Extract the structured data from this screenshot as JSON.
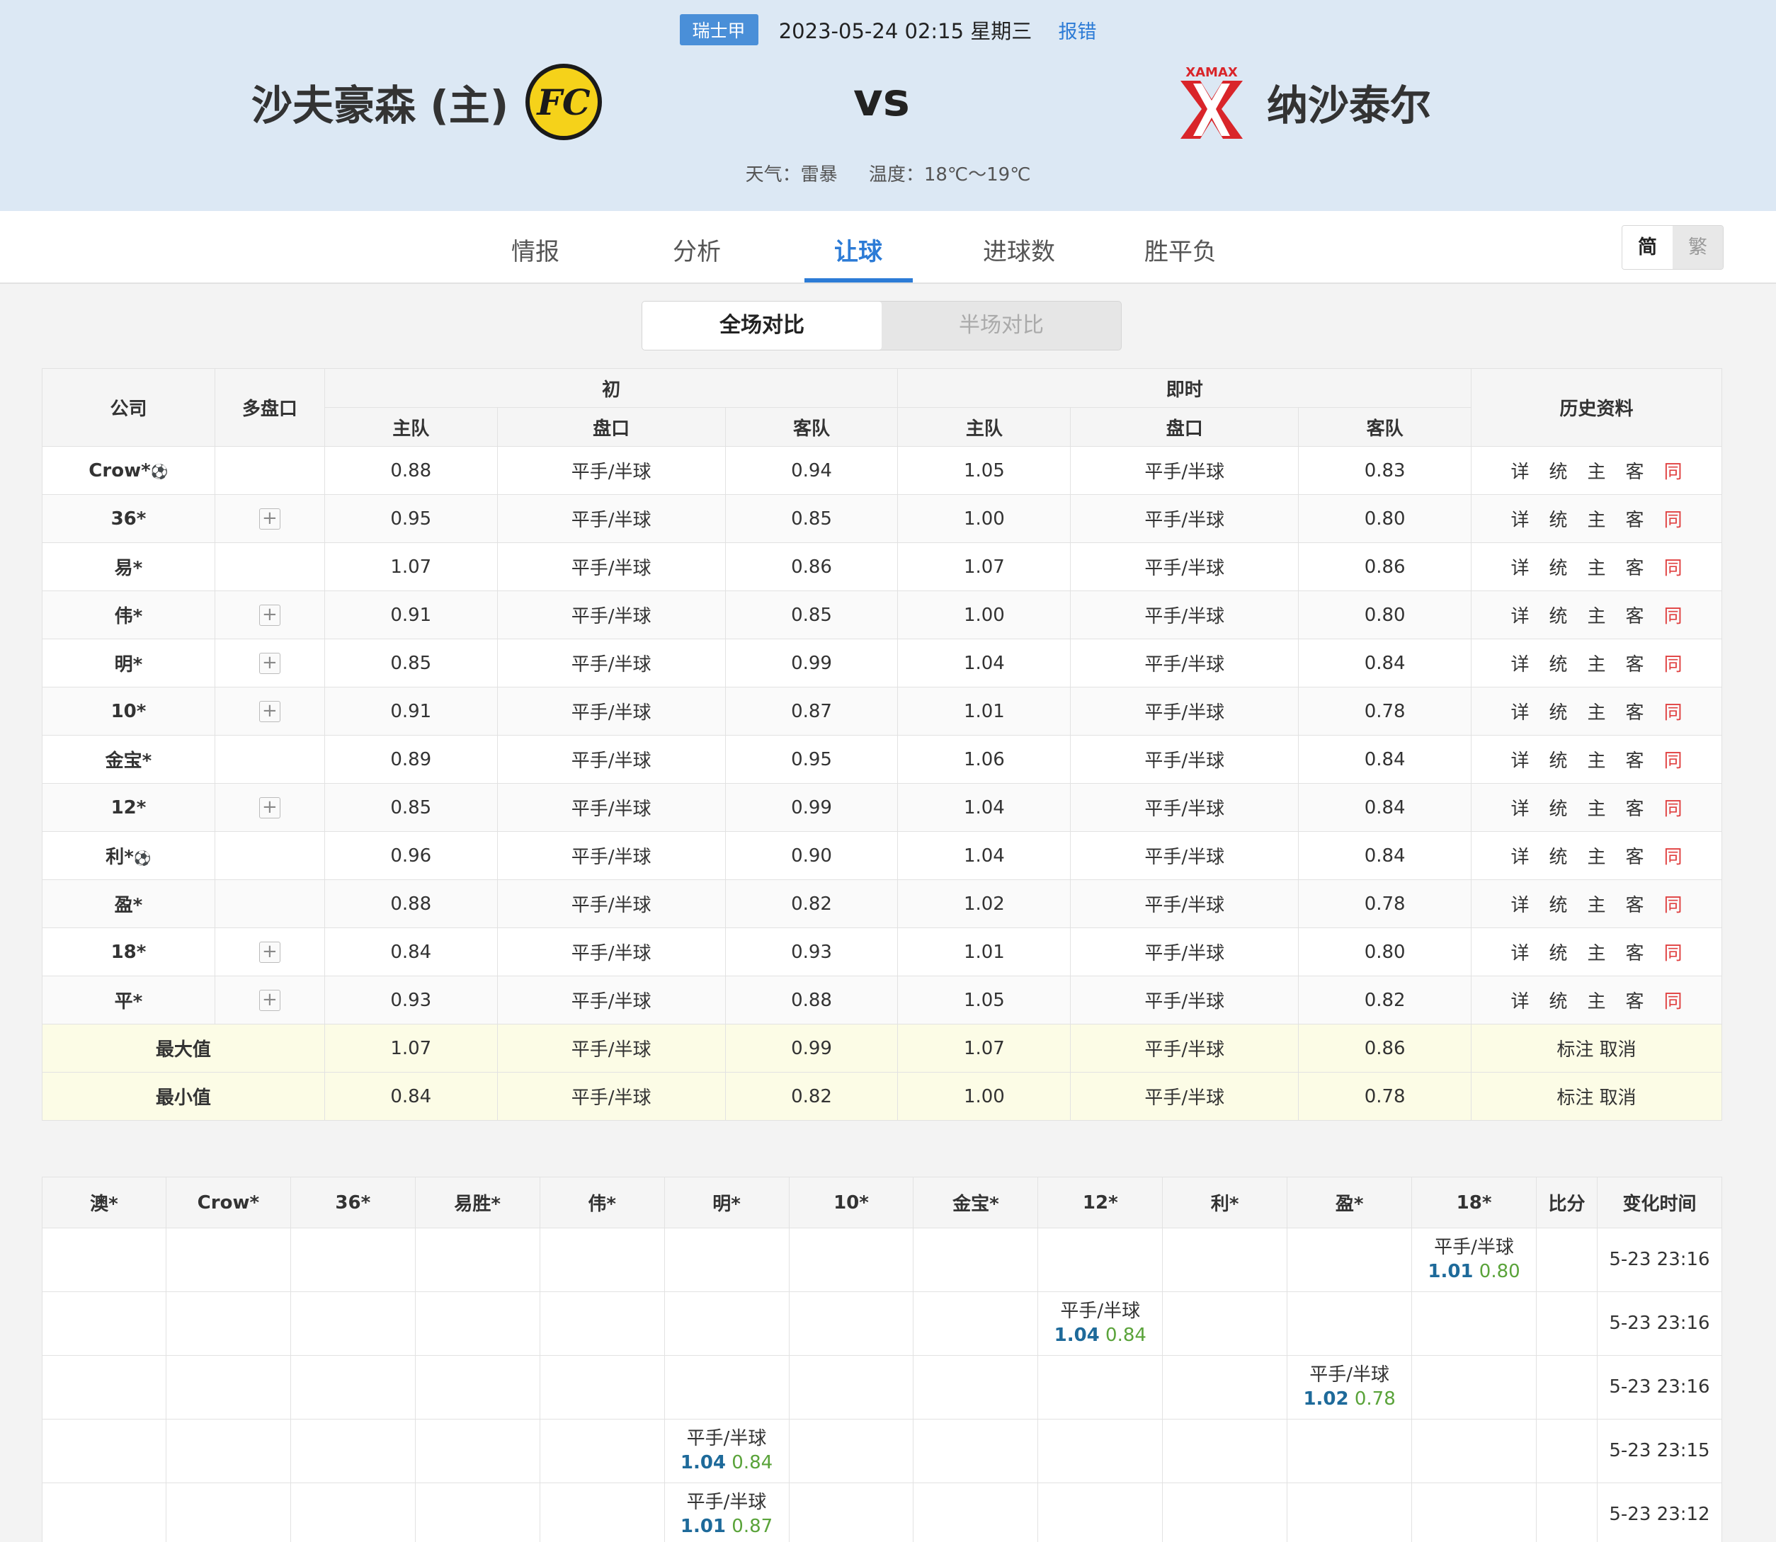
{
  "header": {
    "league": "瑞士甲",
    "datetime": "2023-05-24 02:15 星期三",
    "report": "报错",
    "home_team": "沙夫豪森 (主)",
    "vs": "vs",
    "away_team": "纳沙泰尔",
    "weather_label": "天气：雷暴",
    "temperature_label": "温度：18℃～19℃",
    "home_logo_text": "FC",
    "away_logo_text": "XAMAX"
  },
  "nav": {
    "tabs": [
      "情报",
      "分析",
      "让球",
      "进球数",
      "胜平负"
    ],
    "active": 2
  },
  "lang": {
    "simplified": "简",
    "traditional": "繁"
  },
  "segment": {
    "full": "全场对比",
    "half": "半场对比"
  },
  "odds_table": {
    "headers": {
      "company": "公司",
      "multi": "多盘口",
      "initial": "初",
      "live": "即时",
      "history": "历史资料",
      "home": "主队",
      "line": "盘口",
      "away": "客队"
    },
    "history_links": [
      "详",
      "统",
      "主",
      "客",
      "同"
    ],
    "rows": [
      {
        "company": "Crow*",
        "ball": true,
        "multi": false,
        "ih": "0.88",
        "il": "平手/半球",
        "ia": "0.94",
        "lh": "1.05",
        "ll": "平手/半球",
        "la": "0.83"
      },
      {
        "company": "36*",
        "ball": false,
        "multi": true,
        "ih": "0.95",
        "il": "平手/半球",
        "ia": "0.85",
        "lh": "1.00",
        "ll": "平手/半球",
        "la": "0.80"
      },
      {
        "company": "易*",
        "ball": false,
        "multi": false,
        "ih": "1.07",
        "il": "平手/半球",
        "ia": "0.86",
        "lh": "1.07",
        "ll": "平手/半球",
        "la": "0.86"
      },
      {
        "company": "伟*",
        "ball": false,
        "multi": true,
        "ih": "0.91",
        "il": "平手/半球",
        "ia": "0.85",
        "lh": "1.00",
        "ll": "平手/半球",
        "la": "0.80"
      },
      {
        "company": "明*",
        "ball": false,
        "multi": true,
        "ih": "0.85",
        "il": "平手/半球",
        "ia": "0.99",
        "lh": "1.04",
        "ll": "平手/半球",
        "la": "0.84"
      },
      {
        "company": "10*",
        "ball": false,
        "multi": true,
        "ih": "0.91",
        "il": "平手/半球",
        "ia": "0.87",
        "lh": "1.01",
        "ll": "平手/半球",
        "la": "0.78"
      },
      {
        "company": "金宝*",
        "ball": false,
        "multi": false,
        "ih": "0.89",
        "il": "平手/半球",
        "ia": "0.95",
        "lh": "1.06",
        "ll": "平手/半球",
        "la": "0.84"
      },
      {
        "company": "12*",
        "ball": false,
        "multi": true,
        "ih": "0.85",
        "il": "平手/半球",
        "ia": "0.99",
        "lh": "1.04",
        "ll": "平手/半球",
        "la": "0.84"
      },
      {
        "company": "利*",
        "ball": true,
        "multi": false,
        "ih": "0.96",
        "il": "平手/半球",
        "ia": "0.90",
        "lh": "1.04",
        "ll": "平手/半球",
        "la": "0.84"
      },
      {
        "company": "盈*",
        "ball": false,
        "multi": false,
        "ih": "0.88",
        "il": "平手/半球",
        "ia": "0.82",
        "lh": "1.02",
        "ll": "平手/半球",
        "la": "0.78"
      },
      {
        "company": "18*",
        "ball": false,
        "multi": true,
        "ih": "0.84",
        "il": "平手/半球",
        "ia": "0.93",
        "lh": "1.01",
        "ll": "平手/半球",
        "la": "0.80"
      },
      {
        "company": "平*",
        "ball": false,
        "multi": true,
        "ih": "0.93",
        "il": "平手/半球",
        "ia": "0.88",
        "lh": "1.05",
        "ll": "平手/半球",
        "la": "0.82"
      }
    ],
    "max": {
      "label": "最大值",
      "ih": "1.07",
      "il": "平手/半球",
      "ia": "0.99",
      "lh": "1.07",
      "ll": "平手/半球",
      "la": "0.86",
      "action": "标注 取消"
    },
    "min": {
      "label": "最小值",
      "ih": "0.84",
      "il": "平手/半球",
      "ia": "0.82",
      "lh": "1.00",
      "ll": "平手/半球",
      "la": "0.78",
      "action": "标注 取消"
    }
  },
  "change_table": {
    "headers": [
      "澳*",
      "Crow*",
      "36*",
      "易胜*",
      "伟*",
      "明*",
      "10*",
      "金宝*",
      "12*",
      "利*",
      "盈*",
      "18*",
      "比分",
      "变化时间"
    ],
    "rows": [
      {
        "col": 11,
        "line": "平手/半球",
        "home": "1.01",
        "away": "0.80",
        "time": "5-23 23:16"
      },
      {
        "col": 8,
        "line": "平手/半球",
        "home": "1.04",
        "away": "0.84",
        "time": "5-23 23:16"
      },
      {
        "col": 10,
        "line": "平手/半球",
        "home": "1.02",
        "away": "0.78",
        "time": "5-23 23:16"
      },
      {
        "col": 5,
        "line": "平手/半球",
        "home": "1.04",
        "away": "0.84",
        "time": "5-23 23:15"
      },
      {
        "col": 5,
        "line": "平手/半球",
        "home": "1.01",
        "away": "0.87",
        "time": "5-23 23:12"
      }
    ]
  }
}
